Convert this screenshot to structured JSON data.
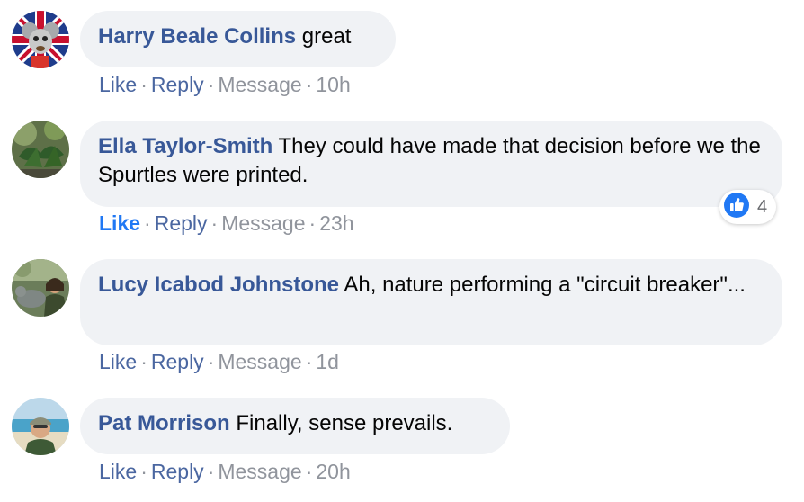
{
  "comments": [
    {
      "author": "Harry Beale Collins",
      "text": "great",
      "actions": {
        "like": "Like",
        "reply": "Reply",
        "message": "Message",
        "time": "10h"
      }
    },
    {
      "author": "Ella Taylor-Smith",
      "text": "They could have made that decision before we the Spurtles were printed.",
      "actions": {
        "like": "Like",
        "reply": "Reply",
        "message": "Message",
        "time": "23h"
      },
      "reaction": {
        "icon": "thumbs-up-icon",
        "count": "4",
        "color": "#2078f4"
      }
    },
    {
      "author": "Lucy Icabod Johnstone",
      "text": "Ah, nature performing a \"circuit breaker\"...",
      "actions": {
        "like": "Like",
        "reply": "Reply",
        "message": "Message",
        "time": "1d"
      }
    },
    {
      "author": "Pat Morrison",
      "text": "Finally, sense prevails.",
      "actions": {
        "like": "Like",
        "reply": "Reply",
        "message": "Message",
        "time": "20h"
      }
    }
  ],
  "dot": "·",
  "colors": {
    "author": "#385898",
    "bubble": "#f0f2f5",
    "meta": "#90949c",
    "liked": "#2078f4"
  }
}
